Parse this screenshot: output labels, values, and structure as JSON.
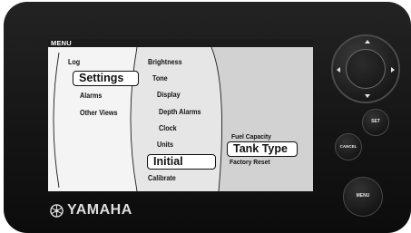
{
  "screen": {
    "title": "MENU",
    "column1": {
      "items": [
        "Log",
        "Settings",
        "Alarms",
        "Other Views"
      ],
      "selected": "Settings"
    },
    "column2": {
      "items": [
        "Brightness",
        "Tone",
        "Display",
        "Depth Alarms",
        "Clock",
        "Units",
        "Initial",
        "Calibrate"
      ],
      "selected": "Initial"
    },
    "column3": {
      "items": [
        "Fuel Capacity",
        "Tank Type",
        "Factory Reset"
      ],
      "selected": "Tank Type"
    }
  },
  "brand": {
    "name": "YAMAHA",
    "logo_icon": "yamaha-tuning-fork-logo"
  },
  "controls": {
    "dpad_icons": [
      "up-arrow-icon",
      "down-arrow-icon",
      "left-arrow-icon",
      "right-arrow-icon"
    ],
    "set_label": "SET",
    "cancel_label": "CANCEL",
    "menu_label": "MENU"
  },
  "colors": {
    "bezel": "#151515",
    "screen_background": "#ffffff",
    "panel_light": "#f4f4f4",
    "panel_mid": "#e6e6e6",
    "panel_dark": "#d2d2d2",
    "text": "#111111"
  }
}
